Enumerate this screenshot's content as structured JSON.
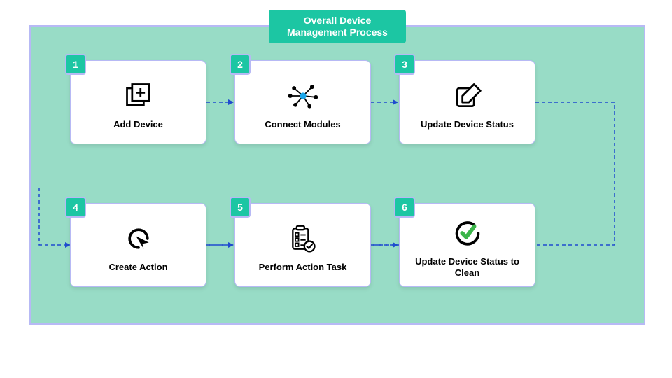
{
  "title": "Overall Device\nManagement Process",
  "accent_color": "#1cc6a3",
  "panel_color": "#98dcc6",
  "border_color": "#b7b9f5",
  "steps": [
    {
      "num": "1",
      "label": "Add Device",
      "icon": "add-device-icon"
    },
    {
      "num": "2",
      "label": "Connect Modules",
      "icon": "network-icon"
    },
    {
      "num": "3",
      "label": "Update Device Status",
      "icon": "edit-note-icon"
    },
    {
      "num": "4",
      "label": "Create Action",
      "icon": "pointer-target-icon"
    },
    {
      "num": "5",
      "label": "Perform Action Task",
      "icon": "checklist-icon"
    },
    {
      "num": "6",
      "label": "Update Device Status to Clean",
      "icon": "check-circle-icon"
    }
  ]
}
